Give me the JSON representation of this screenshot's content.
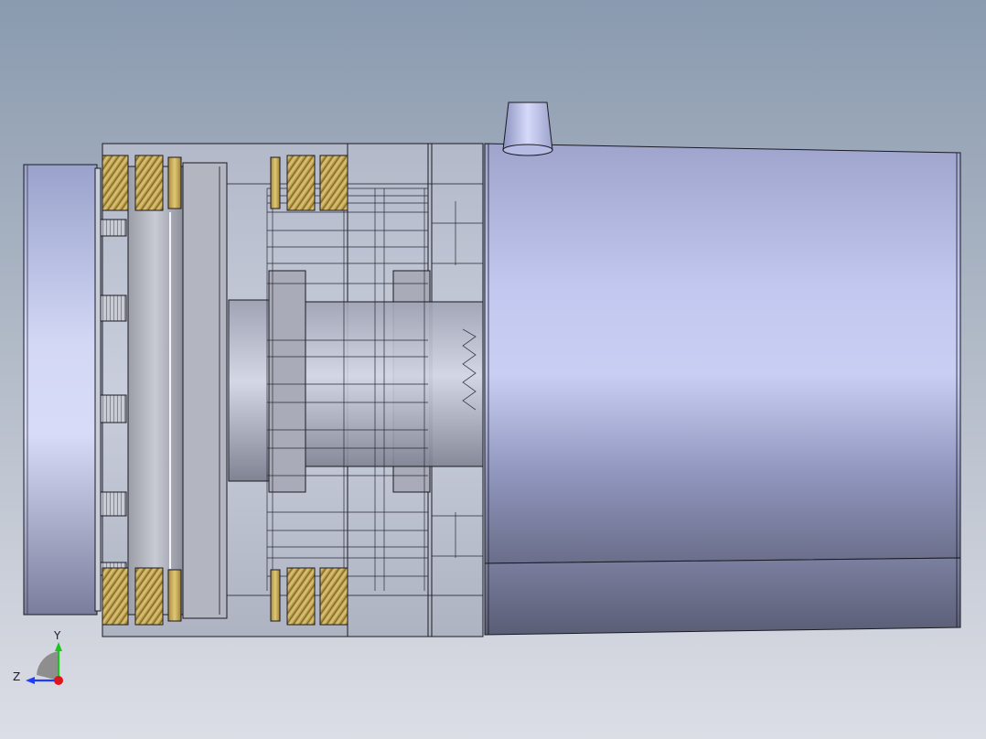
{
  "viewport": {
    "background_top": "#8b9bb0",
    "background_bottom": "#dcdee6"
  },
  "model": {
    "body_color": "#b8bfe6",
    "insert_color": "#c9ad5a",
    "transparent_tint": "#c4cada"
  },
  "triad": {
    "y_label": "Y",
    "z_label": "Z",
    "colors": {
      "x": "#e0141c",
      "y": "#1dc41d",
      "z": "#1e3cff"
    }
  }
}
